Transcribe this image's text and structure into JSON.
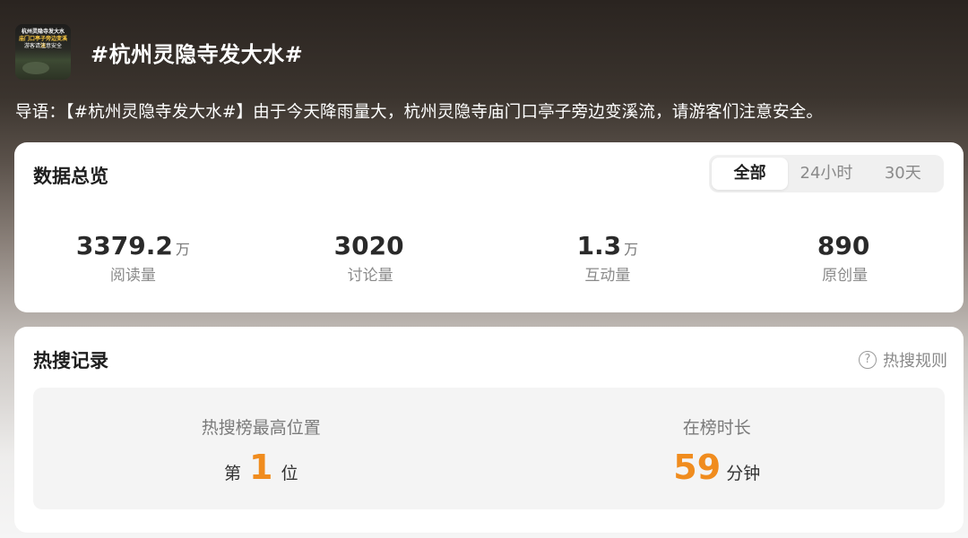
{
  "header": {
    "thumbnail": {
      "line1": "杭州灵隐寺发大水",
      "line2": "庙门口亭子旁边变溪流",
      "line3": "游客请注意安全"
    },
    "title": "#杭州灵隐寺发大水#"
  },
  "lead": "导语：【#杭州灵隐寺发大水#】由于今天降雨量大，杭州灵隐寺庙门口亭子旁边变溪流，请游客们注意安全。",
  "overview": {
    "title": "数据总览",
    "tabs": [
      {
        "label": "全部",
        "active": true
      },
      {
        "label": "24小时",
        "active": false
      },
      {
        "label": "30天",
        "active": false
      }
    ],
    "stats": [
      {
        "value": "3379.2",
        "unit": "万",
        "label": "阅读量"
      },
      {
        "value": "3020",
        "unit": "",
        "label": "讨论量"
      },
      {
        "value": "1.3",
        "unit": "万",
        "label": "互动量"
      },
      {
        "value": "890",
        "unit": "",
        "label": "原创量"
      }
    ]
  },
  "hot_record": {
    "title": "热搜记录",
    "rules_label": "热搜规则",
    "rules_icon": "question-circle-icon",
    "peak": {
      "label": "热搜榜最高位置",
      "prefix": "第",
      "value": "1",
      "suffix": "位"
    },
    "duration": {
      "label": "在榜时长",
      "value": "59",
      "suffix": "分钟"
    }
  },
  "colors": {
    "accent": "#f08c1e",
    "tab_bg": "#f0f0f0",
    "muted_text": "#8a8a8a"
  }
}
